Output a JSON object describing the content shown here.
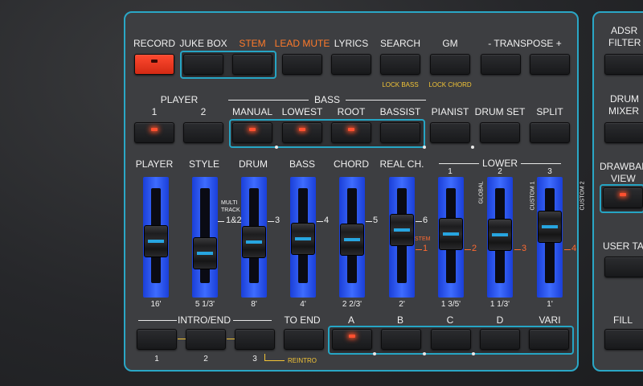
{
  "top_row": {
    "labels": [
      "RECORD",
      "JUKE BOX",
      "STEM",
      "LEAD MUTE",
      "LYRICS",
      "SEARCH",
      "GM",
      "- TRANSPOSE +"
    ],
    "sub_labels": [
      "LOCK BASS",
      "LOCK CHORD"
    ]
  },
  "second_row": {
    "group_player": "PLAYER",
    "group_bass": "BASS",
    "labels": [
      "1",
      "2",
      "MANUAL",
      "LOWEST",
      "ROOT",
      "BASSIST",
      "PIANIST",
      "DRUM SET",
      "SPLIT"
    ]
  },
  "sliders": {
    "labels": [
      "PLAYER",
      "STYLE",
      "DRUM",
      "BASS",
      "CHORD",
      "REAL CH."
    ],
    "lower_group": "LOWER",
    "lower_numbers": [
      "1",
      "2",
      "3"
    ],
    "style_side": [
      "MULTI",
      "TRACK"
    ],
    "side_numbers": [
      "1&2",
      "3",
      "4",
      "5",
      "6"
    ],
    "stem_label": "STEM",
    "orange_numbers": [
      "1",
      "2",
      "3",
      "4"
    ],
    "lower_side": [
      "GLOBAL",
      "CUSTOM 1",
      "CUSTOM 2"
    ],
    "footages": [
      "16'",
      "5 1/3'",
      "8'",
      "4'",
      "2 2/3'",
      "2'",
      "1 3/5'",
      "1 1/3'",
      "1'"
    ]
  },
  "bottom_row": {
    "intro_end": "INTRO/END",
    "to_end": "TO END",
    "labels": [
      "A",
      "B",
      "C",
      "D",
      "VARI"
    ],
    "numbers": [
      "1",
      "2",
      "3"
    ],
    "reintro": "REINTRO"
  },
  "right_panel": {
    "labels": [
      "ADSR",
      "FILTER",
      "DRUM",
      "MIXER",
      "DRAWBAR",
      "VIEW",
      "USER TAB",
      "FILL"
    ]
  },
  "colors": {
    "accent": "#2aa7c6",
    "led_on": "#ff5030",
    "record": "#e8341c",
    "slider": "#2f5cf0",
    "stem": "#ff7a2a"
  }
}
